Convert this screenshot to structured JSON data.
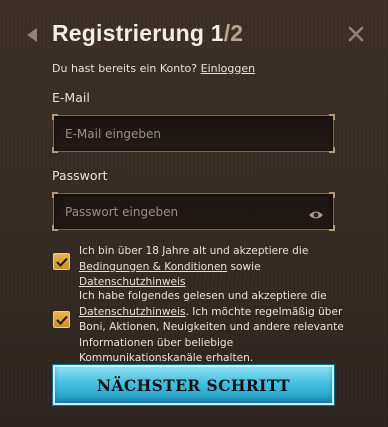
{
  "header": {
    "title": "Registrierung",
    "step_current": "1",
    "step_separator_total": "/2"
  },
  "login": {
    "prompt": "Du hast bereits ein Konto?",
    "link": "Einloggen"
  },
  "email": {
    "label": "E-Mail",
    "placeholder": "E-Mail eingeben"
  },
  "password": {
    "label": "Passwort",
    "placeholder": "Passwort eingeben"
  },
  "consent_age": {
    "checked": true,
    "text_before": "Ich bin über 18 Jahre alt und akzeptiere die",
    "link_terms": "Bedingungen & Konditionen",
    "text_middle": "sowie",
    "link_privacy": "Datenschutzhinweis"
  },
  "consent_marketing": {
    "checked": true,
    "text_before": "Ich habe folgendes gelesen und akzeptiere die",
    "link_privacy": "Datenschutzhinweis",
    "text_after": ". Ich möchte regelmäßig über Boni, Aktionen, Neuigkeiten und andere relevante Informationen über beliebige Kommunikationskanäle erhalten."
  },
  "next_button": {
    "label": "NÄCHSTER SCHRITT"
  },
  "icons": {
    "back": "back-arrow-icon",
    "close": "close-icon",
    "eye": "eye-icon",
    "check": "checkmark-icon"
  },
  "colors": {
    "accent_gold": "#d9a63e",
    "button_cyan": "#44bfe0",
    "background": "#3a2f27"
  }
}
